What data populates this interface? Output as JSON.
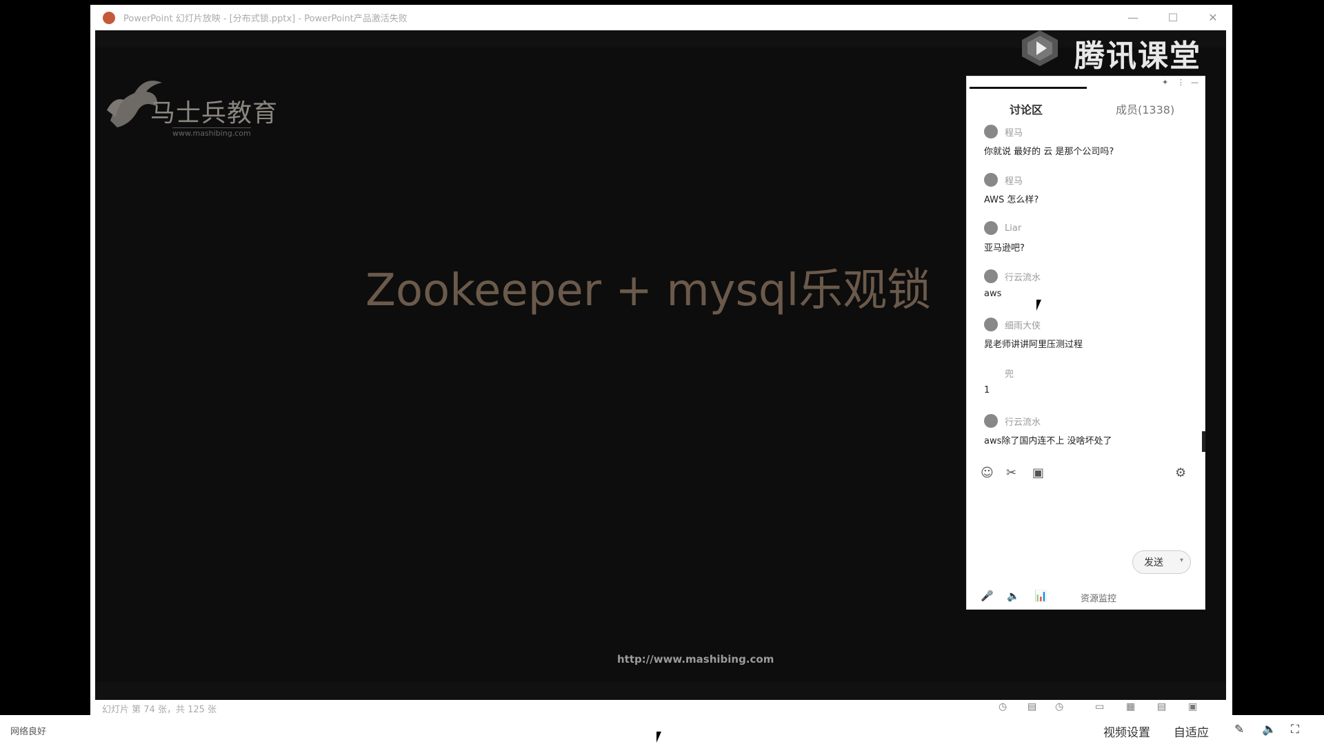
{
  "window": {
    "title": "PowerPoint 幻灯片放映 - [分布式锁.pptx] - PowerPoint产品激活失败",
    "controls": {
      "minimize": "—",
      "maximize": "☐",
      "close": "✕"
    }
  },
  "slide": {
    "logo_name": "马士兵教育",
    "logo_url": "www.mashibing.com",
    "title": "Zookeeper + mysql乐观锁",
    "footer_url": "http://www.mashibing.com"
  },
  "tencent": {
    "label": "腾讯课堂"
  },
  "chat": {
    "title_controls": {
      "pin": "✦",
      "more": "⋮",
      "minimize": "—"
    },
    "tab_discussion": "讨论区",
    "tab_members": "成员(1338)",
    "messages": [
      {
        "nick": "程马",
        "text": "你就说 最好的 云 是那个公司吗?"
      },
      {
        "nick": "程马",
        "text": "AWS 怎么样?"
      },
      {
        "nick": "Liar",
        "text": "亚马逊吧?"
      },
      {
        "nick": "行云流水",
        "text": "aws"
      },
      {
        "nick": "细雨大侠",
        "text": "晁老师讲讲阿里压测过程"
      },
      {
        "nick": "兜",
        "text": "1"
      },
      {
        "nick": "行云流水",
        "text": "aws除了国内连不上 没啥坏处了"
      }
    ],
    "tools": {
      "emoji": "☺",
      "scissors": "✂",
      "image": "▣",
      "settings": "⚙"
    },
    "send_label": "发送",
    "send_dropdown": "▾",
    "bottom": {
      "mic": "🎤",
      "speaker": "🔈",
      "chart": "📊",
      "resources": "资源监控"
    }
  },
  "ppt_status": {
    "text": "幻灯片 第 74 张，共 125 张",
    "icons": [
      "◷",
      "▤",
      "◷",
      "▭",
      "▦",
      "▤",
      "▣"
    ]
  },
  "appbar": {
    "network": "网络良好",
    "video_settings": "视频设置",
    "adaptive": "自适应",
    "icons": {
      "pen": "✎",
      "volume": "🔈",
      "fullscreen": "⛶"
    }
  },
  "colors": {
    "slide_bg": "#0d0d0d",
    "title_text": "#6b5a4b",
    "chat_bg": "#ffffff"
  }
}
